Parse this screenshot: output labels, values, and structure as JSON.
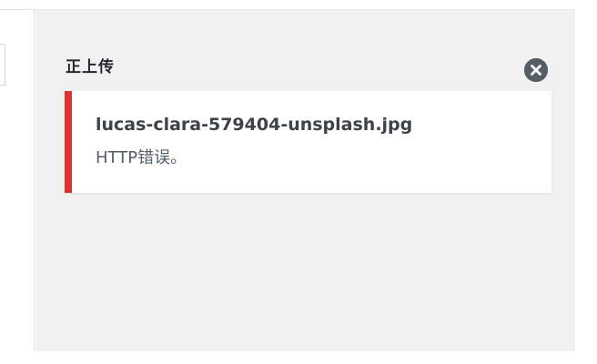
{
  "upload_panel": {
    "title": "正上传",
    "dismiss_icon": "close-circle-icon"
  },
  "upload_error": {
    "filename": "lucas-clara-579404-unsplash.jpg",
    "message": "HTTP错误。",
    "status_color": "#dc3232"
  }
}
